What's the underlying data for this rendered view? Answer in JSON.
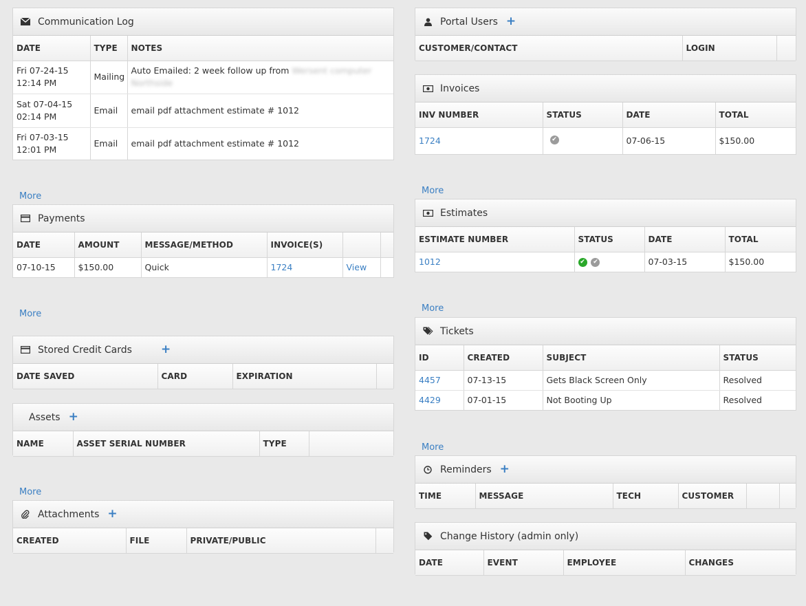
{
  "communication_log": {
    "title": "Communication Log",
    "icon": "envelope-icon",
    "columns": [
      "DATE",
      "TYPE",
      "NOTES"
    ],
    "rows": [
      {
        "date_line1": "Fri 07-24-15",
        "date_line2": "12:14 PM",
        "type": "Mailing",
        "notes": "Auto Emailed: 2 week follow up from",
        "notes_blurred": "Wersent computer Northside"
      },
      {
        "date_line1": "Sat 07-04-15",
        "date_line2": "02:14 PM",
        "type": "Email",
        "notes": "email pdf attachment estimate # 1012"
      },
      {
        "date_line1": "Fri 07-03-15",
        "date_line2": "12:01 PM",
        "type": "Email",
        "notes": "email pdf attachment estimate # 1012"
      }
    ],
    "more": "More"
  },
  "payments": {
    "title": "Payments",
    "icon": "credit-card-icon",
    "columns": [
      "DATE",
      "AMOUNT",
      "MESSAGE/METHOD",
      "INVOICE(S)",
      "",
      ""
    ],
    "rows": [
      {
        "date": "07-10-15",
        "amount": "$150.00",
        "method": "Quick",
        "invoice": "1724",
        "action": "View"
      }
    ],
    "more": "More"
  },
  "stored_cards": {
    "title": "Stored Credit Cards",
    "icon": "credit-card-icon",
    "columns": [
      "DATE SAVED",
      "CARD",
      "EXPIRATION",
      ""
    ]
  },
  "assets": {
    "title": "Assets",
    "columns": [
      "NAME",
      "ASSET SERIAL NUMBER",
      "TYPE",
      ""
    ],
    "more": "More"
  },
  "attachments": {
    "title": "Attachments",
    "icon": "paperclip-icon",
    "columns": [
      "CREATED",
      "FILE",
      "PRIVATE/PUBLIC",
      ""
    ]
  },
  "portal_users": {
    "title": "Portal Users",
    "icon": "user-icon",
    "columns": [
      "CUSTOMER/CONTACT",
      "LOGIN",
      ""
    ]
  },
  "invoices": {
    "title": "Invoices",
    "icon": "money-icon",
    "columns": [
      "INV NUMBER",
      "STATUS",
      "DATE",
      "TOTAL"
    ],
    "rows": [
      {
        "number": "1724",
        "status": "gray-check",
        "date": "07-06-15",
        "total": "$150.00"
      }
    ],
    "more": "More"
  },
  "estimates": {
    "title": "Estimates",
    "icon": "money-icon",
    "columns": [
      "ESTIMATE NUMBER",
      "STATUS",
      "DATE",
      "TOTAL"
    ],
    "rows": [
      {
        "number": "1012",
        "status": "green-check gray-check",
        "date": "07-03-15",
        "total": "$150.00"
      }
    ],
    "more": "More"
  },
  "tickets": {
    "title": "Tickets",
    "icon": "tags-icon",
    "columns": [
      "ID",
      "CREATED",
      "SUBJECT",
      "STATUS"
    ],
    "rows": [
      {
        "id": "4457",
        "created": "07-13-15",
        "subject": "Gets Black Screen Only",
        "status": "Resolved"
      },
      {
        "id": "4429",
        "created": "07-01-15",
        "subject": "Not Booting Up",
        "status": "Resolved"
      }
    ],
    "more": "More"
  },
  "reminders": {
    "title": "Reminders",
    "icon": "clock-icon",
    "columns": [
      "TIME",
      "MESSAGE",
      "TECH",
      "CUSTOMER",
      "",
      ""
    ]
  },
  "change_history": {
    "title": "Change History (admin only)",
    "icon": "tag-icon",
    "columns": [
      "DATE",
      "EVENT",
      "EMPLOYEE",
      "CHANGES"
    ]
  },
  "plus_label": "+",
  "check_glyph": "✔",
  "colors": {
    "link": "#3a7fc3",
    "status_ok": "#2aa82a",
    "status_neutral": "#9b9b9b"
  }
}
